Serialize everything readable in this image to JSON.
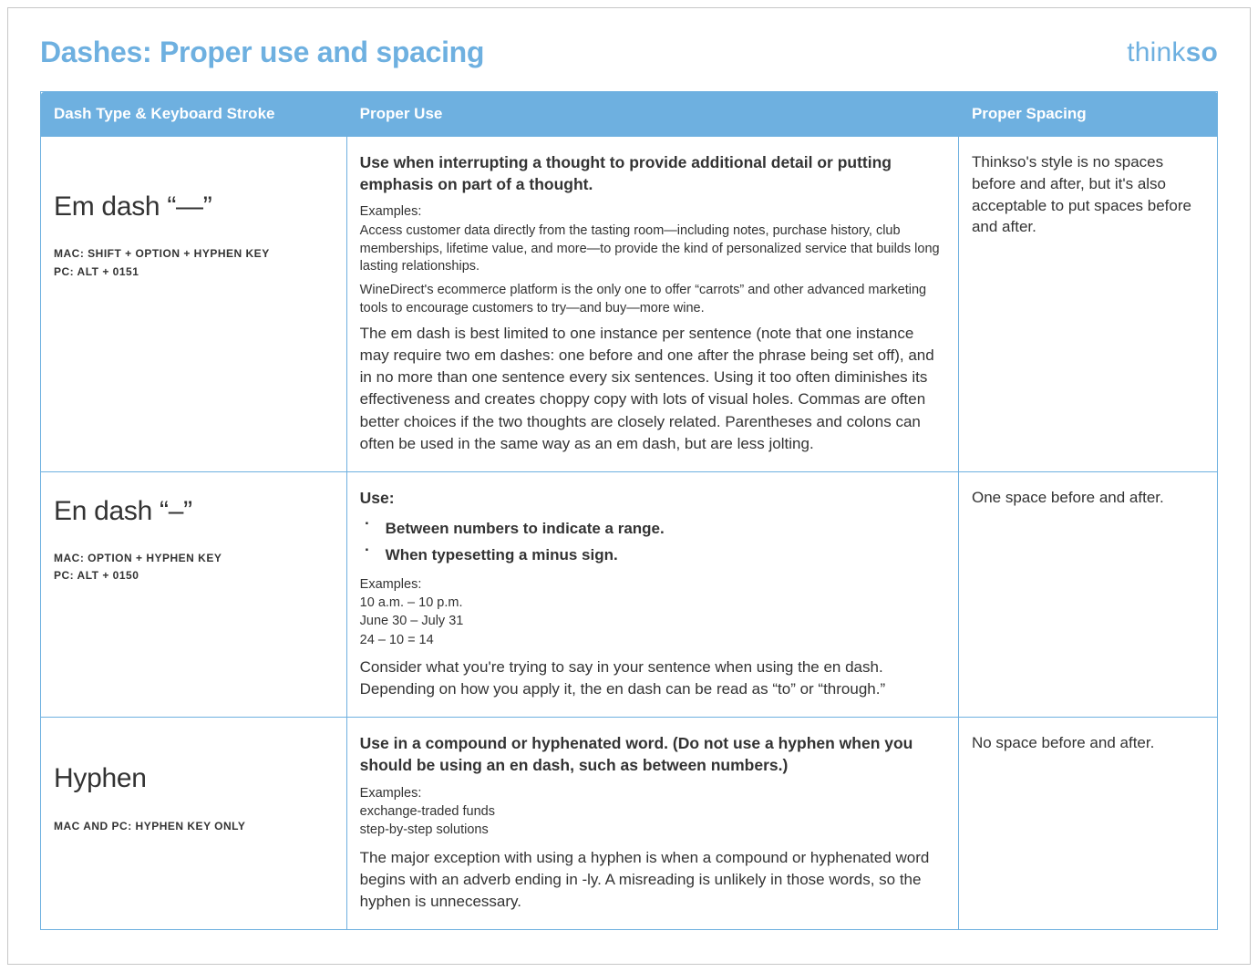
{
  "title": "Dashes: Proper use and spacing",
  "brand": {
    "part1": "think",
    "part2": "so"
  },
  "columns": {
    "c1": "Dash Type & Keyboard Stroke",
    "c2": "Proper Use",
    "c3": "Proper Spacing"
  },
  "rows": {
    "em": {
      "name": "Em dash  “—”",
      "kbd_mac": "MAC: SHIFT + OPTION + HYPHEN KEY",
      "kbd_pc": "PC: ALT + 0151",
      "use_heading": "Use when interrupting a thought to provide additional detail or putting emphasis on part of a thought.",
      "examples_label": "Examples:",
      "example1": "Access customer data directly from the tasting room—including notes, purchase history, club memberships, lifetime value, and more—to provide the kind of personalized service that builds long lasting relationships.",
      "example2": "WineDirect's ecommerce platform is the only one to offer “carrots” and other advanced marketing tools to encourage customers to try—and buy—more wine.",
      "body": "The em dash is best limited to one instance per sentence (note that one instance may require two em dashes: one before and one after the phrase being set off), and in no more than one sentence every six sentences. Using it too often diminishes its effectiveness and creates choppy copy with lots of visual holes. Commas are often better choices if the two thoughts are closely related. Parentheses and colons can often be used in the same way as an em dash, but are less jolting.",
      "spacing": "Thinkso's style is no spaces before and after, but it's also acceptable to put spaces before and after."
    },
    "en": {
      "name": "En dash “–”",
      "kbd_mac": "MAC: OPTION + HYPHEN KEY",
      "kbd_pc": "PC: ALT + 0150",
      "use_heading": "Use:",
      "bullet1": "Between numbers to indicate a range.",
      "bullet2": "When typesetting a minus sign.",
      "examples_label": "Examples:",
      "example1": "10 a.m. – 10 p.m.",
      "example2": "June 30 – July 31",
      "example3": "24 – 10 = 14",
      "body": "Consider what you're trying to say in your sentence when using the en dash. Depending on how you apply it, the en dash can be read as “to” or “through.”",
      "spacing": "One space before and after."
    },
    "hyphen": {
      "name": "Hyphen",
      "kbd": "MAC AND PC: HYPHEN KEY ONLY",
      "use_heading": "Use in a compound or hyphenated word.  (Do not use a hyphen when you should be using an en dash, such as between numbers.)",
      "examples_label": "Examples:",
      "example1": "exchange-traded funds",
      "example2": "step-by-step solutions",
      "body": "The major exception with using a hyphen is when a compound or hyphenated word begins with an adverb ending in -ly. A misreading is unlikely in those words, so the hyphen is unnecessary.",
      "spacing": "No space before and after."
    }
  }
}
